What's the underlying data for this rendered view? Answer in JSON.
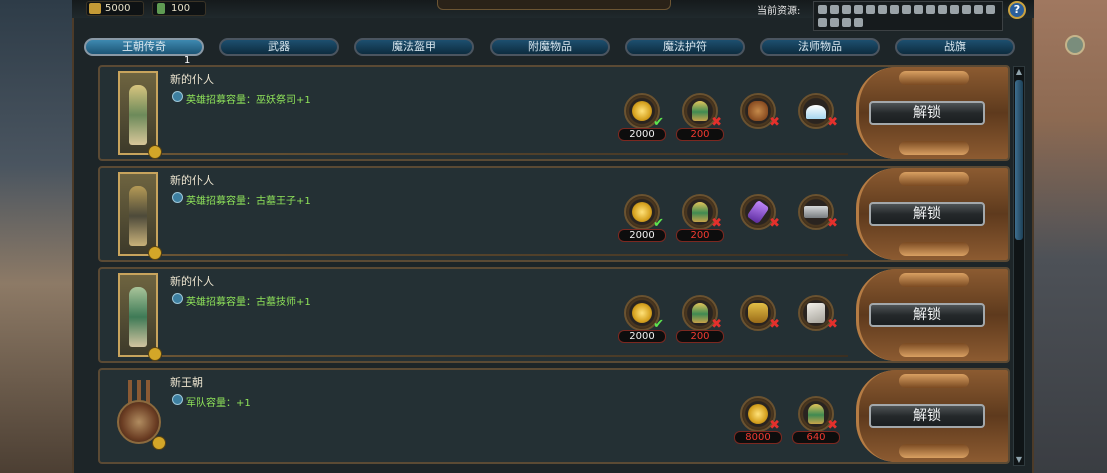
{
  "resources": {
    "treasury": "5000",
    "canopic": "100",
    "current_label": "当前资源:"
  },
  "help_label": "?",
  "tabs": [
    {
      "label": "王朝传奇",
      "active": true
    },
    {
      "label": "武器",
      "active": false
    },
    {
      "label": "魔法盔甲",
      "active": false
    },
    {
      "label": "附魔物品",
      "active": false
    },
    {
      "label": "魔法护符",
      "active": false
    },
    {
      "label": "法师物品",
      "active": false
    },
    {
      "label": "战旗",
      "active": false
    }
  ],
  "tab_badge": "1",
  "rows": [
    {
      "title": "新的仆人",
      "effect": "英雄招募容量：巫妖祭司+1",
      "unlock_label": "解锁",
      "costs": [
        {
          "icon": "gold-coin-icon",
          "amount": "2000",
          "met": true
        },
        {
          "icon": "canopic-jar-icon",
          "amount": "200",
          "met": false
        },
        {
          "icon": "bread-icon",
          "amount": "",
          "met": false
        },
        {
          "icon": "salt-icon",
          "amount": "",
          "met": false
        }
      ]
    },
    {
      "title": "新的仆人",
      "effect": "英雄招募容量：古墓王子+1",
      "unlock_label": "解锁",
      "costs": [
        {
          "icon": "gold-coin-icon",
          "amount": "2000",
          "met": true
        },
        {
          "icon": "canopic-jar-icon",
          "amount": "200",
          "met": false
        },
        {
          "icon": "purple-crystal-icon",
          "amount": "",
          "met": false
        },
        {
          "icon": "metal-ingot-icon",
          "amount": "",
          "met": false
        }
      ]
    },
    {
      "title": "新的仆人",
      "effect": "英雄招募容量：古墓技师+1",
      "unlock_label": "解锁",
      "costs": [
        {
          "icon": "gold-coin-icon",
          "amount": "2000",
          "met": true
        },
        {
          "icon": "canopic-jar-icon",
          "amount": "200",
          "met": false
        },
        {
          "icon": "golden-mask-icon",
          "amount": "",
          "met": false
        },
        {
          "icon": "stone-block-icon",
          "amount": "",
          "met": false
        }
      ]
    },
    {
      "title": "新王朝",
      "effect": "军队容量：+1",
      "unlock_label": "解锁",
      "costs": [
        {
          "icon": "gold-coin-icon",
          "amount": "8000",
          "met": false
        },
        {
          "icon": "canopic-jar-icon",
          "amount": "640",
          "met": false
        }
      ]
    }
  ],
  "colors": {
    "effect_text": "#8fe35a",
    "cost_met": "#5ee64e",
    "cost_unmet": "#e5302c",
    "active_tab": "#3e89b0"
  }
}
